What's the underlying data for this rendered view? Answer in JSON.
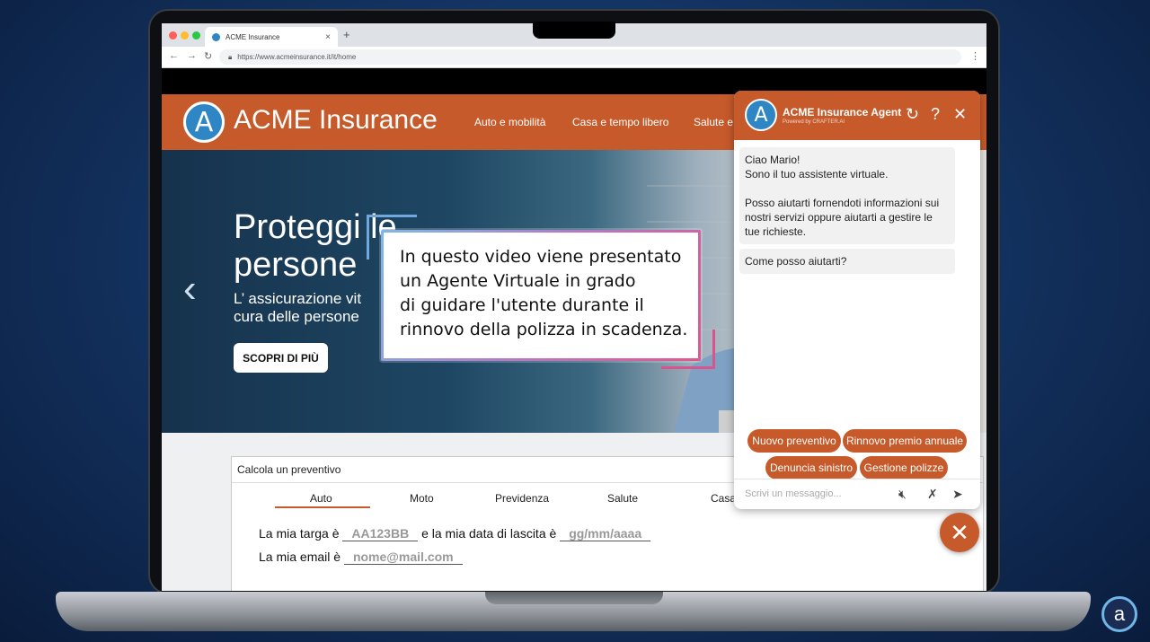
{
  "browser": {
    "tab_title": "ACME Insurance",
    "url": "https://www.acmeinsurance.it/it/home",
    "new_tab_symbol": "+"
  },
  "site": {
    "brand": "ACME Insurance",
    "logo_letter": "A",
    "nav": [
      "Auto e mobilità",
      "Casa e tempo libero",
      "Salute e"
    ],
    "hero": {
      "title_line1": "Proteggi le",
      "title_line2": "persone",
      "subtitle_line1": "L’  assicurazione vit",
      "subtitle_line2": "cura delle persone",
      "cta": "SCOPRI DI PIÙ"
    },
    "quote": {
      "title": "Calcola un preventivo",
      "tabs": [
        "Auto",
        "Moto",
        "Previdenza",
        "Salute",
        "Casa"
      ],
      "row1_prefix": "La mia targa è",
      "plate_placeholder": "AA123BB",
      "row1_middle": "e la mia data di lascita è",
      "date_placeholder": "gg/mm/aaaa",
      "row2_prefix": "La mia email è",
      "email_placeholder": "nome@mail.com"
    }
  },
  "caption": {
    "line1": "In questo video viene presentato",
    "line2": "un Agente Virtuale in grado",
    "line3": "di guidare l'utente durante il",
    "line4": "rinnovo della polizza in scadenza."
  },
  "chat": {
    "title": "ACME Insurance Agent",
    "powered": "Powered by CRAFTER.AI",
    "greeting_1": "Ciao Mario!",
    "greeting_2": "Sono il tuo assistente virtuale.",
    "greeting_3": "Posso aiutarti fornendoti informazioni sui nostri servizi oppure aiutarti a gestire le tue richieste.",
    "question": "Come posso aiutarti?",
    "quick_replies": [
      "Nuovo preventivo",
      "Rinnovo premio annuale",
      "Denuncia sinistro",
      "Gestione polizze"
    ],
    "input_placeholder": "Scrivi un messaggio..."
  },
  "colors": {
    "accent": "#c65a2b",
    "logo_blue": "#2f86c5"
  },
  "icons": [
    "refresh-icon",
    "help-icon",
    "close-icon",
    "mute-speaker-icon",
    "mute-mic-icon",
    "send-icon"
  ]
}
